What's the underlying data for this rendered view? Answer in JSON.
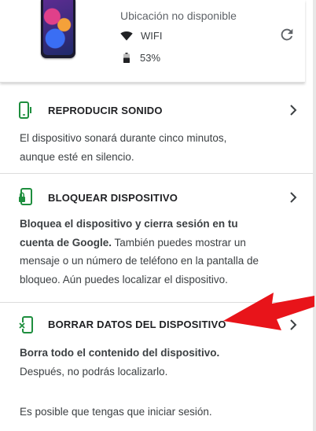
{
  "device": {
    "location": "Ubicación no disponible",
    "network": "WIFI",
    "battery": "53%",
    "network_icon": "wifi-icon",
    "battery_icon": "battery-icon",
    "refresh_icon": "refresh-icon"
  },
  "actions": [
    {
      "title": "REPRODUCIR SONIDO",
      "icon": "phone-ring-icon",
      "desc_bold": "",
      "desc": "El dispositivo sonará durante cinco minutos, aunque esté en silencio."
    },
    {
      "title": "BLOQUEAR DISPOSITIVO",
      "icon": "phone-lock-icon",
      "desc_bold": "Bloquea el dispositivo y cierra sesión en tu cuenta de Google.",
      "desc": "También puedes mostrar un mensaje o un número de teléfono en la pantalla de bloqueo. Aún puedes localizar el dispositivo."
    },
    {
      "title": "BORRAR DATOS DEL DISPOSITIVO",
      "icon": "phone-erase-icon",
      "desc_bold": "Borra todo el contenido del dispositivo.",
      "desc": "Después, no podrás localizarlo.",
      "note": "Es posible que tengas que iniciar sesión."
    }
  ],
  "colors": {
    "accent_green": "#1e8e3e",
    "annotation_red": "#e8141a"
  }
}
